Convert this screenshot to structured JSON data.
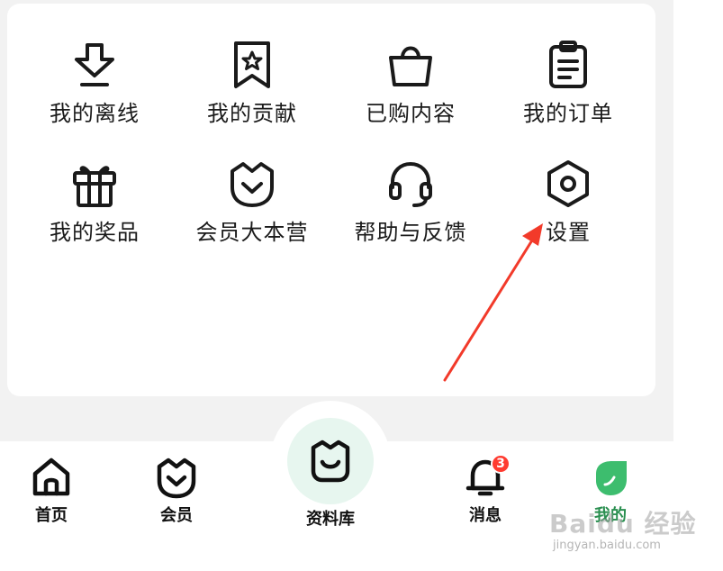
{
  "grid": {
    "offline": "我的离线",
    "contribution": "我的贡献",
    "purchased": "已购内容",
    "orders": "我的订单",
    "prizes": "我的奖品",
    "member_camp": "会员大本营",
    "help": "帮助与反馈",
    "settings": "设置"
  },
  "tabbar": {
    "home": "首页",
    "member": "会员",
    "library": "资料库",
    "messages": "消息",
    "messages_badge": "3",
    "me": "我的"
  },
  "colors": {
    "icon": "#1a1a1a",
    "badge": "#ff3b30",
    "accent_green": "#3dbd6e",
    "library_bg": "#e7f6ef",
    "arrow": "#f23a2a"
  },
  "watermark": {
    "brand": "Baidu 经验",
    "url": "jingyan.baidu.com"
  }
}
